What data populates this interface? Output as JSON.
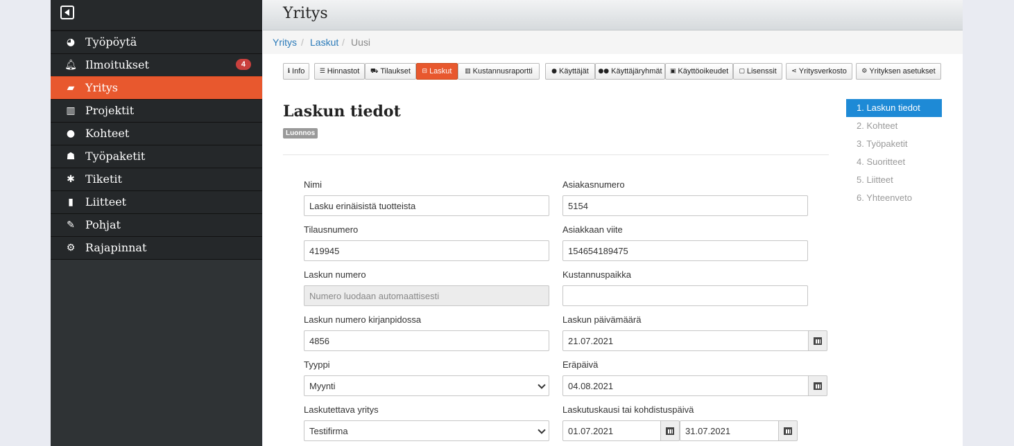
{
  "sidebar": {
    "items": [
      {
        "label": "Työpöytä",
        "icon": "dashboard-icon"
      },
      {
        "label": "Ilmoitukset",
        "icon": "bell-icon",
        "badge": "4"
      },
      {
        "label": "Yritys",
        "icon": "briefcase-icon",
        "active": true
      },
      {
        "label": "Projektit",
        "icon": "bar-chart-icon"
      },
      {
        "label": "Kohteet",
        "icon": "map-marker-icon"
      },
      {
        "label": "Työpaketit",
        "icon": "sitemap-icon"
      },
      {
        "label": "Tiketit",
        "icon": "bug-icon"
      },
      {
        "label": "Liitteet",
        "icon": "file-icon"
      },
      {
        "label": "Pohjat",
        "icon": "pencil-icon"
      },
      {
        "label": "Rajapinnat",
        "icon": "cogs-icon"
      }
    ]
  },
  "header": {
    "title": "Yritys"
  },
  "breadcrumb": {
    "items": [
      "Yritys",
      "Laskut",
      "Uusi"
    ],
    "separator": "/"
  },
  "toolbar": {
    "buttons": [
      {
        "label": "Info",
        "icon": "info-icon"
      },
      {
        "label": "Hinnastot",
        "icon": "list-icon"
      },
      {
        "label": "Tilaukset",
        "icon": "cart-icon"
      },
      {
        "label": "Laskut",
        "icon": "inbox-icon",
        "active": true
      },
      {
        "label": "Kustannusraportti",
        "icon": "bar-chart-icon"
      },
      {
        "label": "Käyttäjät",
        "icon": "user-icon"
      },
      {
        "label": "Käyttäjäryhmät",
        "icon": "users-icon"
      },
      {
        "label": "Käyttöoikeudet",
        "icon": "lock-icon"
      },
      {
        "label": "Lisenssit",
        "icon": "unlock-icon"
      },
      {
        "label": "Yritysverkosto",
        "icon": "share-icon"
      },
      {
        "label": "Yrityksen asetukset",
        "icon": "gear-icon"
      }
    ]
  },
  "page": {
    "title": "Laskun tiedot",
    "status": "Luonnos"
  },
  "form": {
    "nimi": {
      "label": "Nimi",
      "value": "Lasku erinäisistä tuotteista"
    },
    "asiakasnumero": {
      "label": "Asiakasnumero",
      "value": "5154"
    },
    "tilausnumero": {
      "label": "Tilausnumero",
      "value": "419945"
    },
    "asiakkaan_viite": {
      "label": "Asiakkaan viite",
      "value": "154654189475"
    },
    "laskun_numero": {
      "label": "Laskun numero",
      "placeholder": "Numero luodaan automaattisesti"
    },
    "kustannuspaikka": {
      "label": "Kustannuspaikka",
      "value": ""
    },
    "kirjanpito_numero": {
      "label": "Laskun numero kirjanpidossa",
      "value": "4856"
    },
    "laskun_paivamaara": {
      "label": "Laskun päivämäärä",
      "value": "21.07.2021"
    },
    "tyyppi": {
      "label": "Tyyppi",
      "value": "Myynti"
    },
    "erapaiva": {
      "label": "Eräpäivä",
      "value": "04.08.2021"
    },
    "laskutettava_yritys": {
      "label": "Laskutettava yritys",
      "value": "Testifirma"
    },
    "laskutuskausi": {
      "label": "Laskutuskausi tai kohdistuspäivä",
      "start": "01.07.2021",
      "end": "31.07.2021"
    }
  },
  "steps": [
    {
      "label": "1. Laskun tiedot",
      "active": true
    },
    {
      "label": "2. Kohteet"
    },
    {
      "label": "3. Työpaketit"
    },
    {
      "label": "4. Suoritteet"
    },
    {
      "label": "5. Liitteet"
    },
    {
      "label": "6. Yhteenveto"
    }
  ],
  "colors": {
    "accent": "#e8582e",
    "link": "#2a7ab9",
    "step_active": "#1e8ad6",
    "badge": "#c9403d"
  }
}
